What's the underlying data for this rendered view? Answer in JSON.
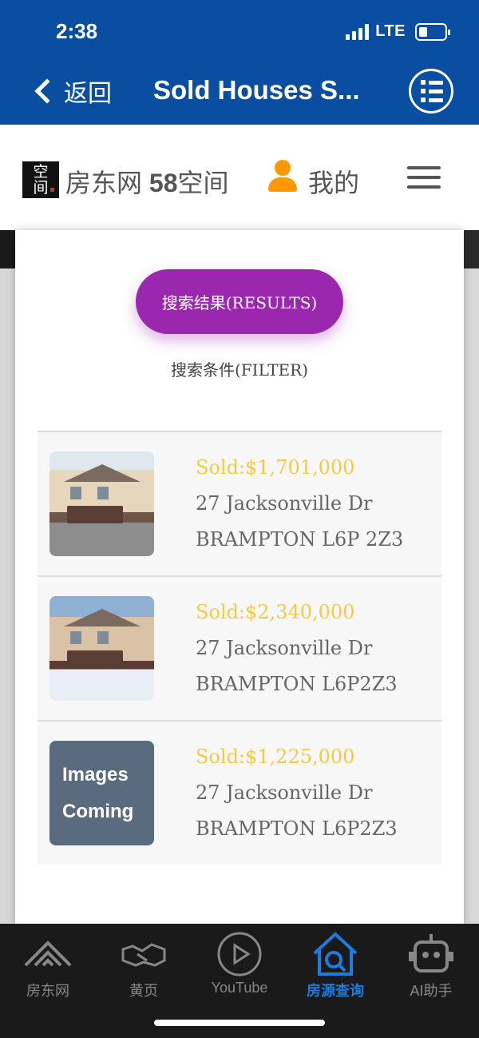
{
  "status_bar": {
    "time": "2:38",
    "network": "LTE"
  },
  "nav": {
    "back_label": "返回",
    "title": "Sold Houses S...",
    "menu_icon": "list-menu-icon"
  },
  "site": {
    "logo_text_top": "空",
    "logo_text_bottom": "间",
    "name": "房东网",
    "name_bold": "58",
    "name_suffix": "空间",
    "my_label": "我的",
    "user_icon_color": "#ff9800"
  },
  "actions": {
    "results_label": "搜索结果(RESULTS)",
    "filter_label": "搜索条件(FILTER)",
    "accent": "#9b27af"
  },
  "listings": [
    {
      "price": "Sold:$1,701,000",
      "street": "27 Jacksonville Dr",
      "city": "BRAMPTON L6P 2Z3",
      "image": "house-photo"
    },
    {
      "price": "Sold:$2,340,000",
      "street": "27 Jacksonville Dr",
      "city": "BRAMPTON L6P2Z3",
      "image": "house-photo"
    },
    {
      "price": "Sold:$1,225,000",
      "street": "27 Jacksonville Dr",
      "city": "BRAMPTON L6P2Z3",
      "image": "placeholder",
      "placeholder_line1": "Images",
      "placeholder_line2": "Coming"
    }
  ],
  "tabs": [
    {
      "label": "房东网",
      "icon": "roof-icon"
    },
    {
      "label": "黄页",
      "icon": "handshake-icon"
    },
    {
      "label": "YouTube",
      "icon": "play-icon"
    },
    {
      "label": "房源查询",
      "icon": "house-search-icon",
      "active": true
    },
    {
      "label": "AI助手",
      "icon": "robot-icon"
    }
  ],
  "colors": {
    "nav_blue": "#0a4ea2",
    "price_gold": "#f6c944",
    "tab_active": "#1e7be0"
  }
}
